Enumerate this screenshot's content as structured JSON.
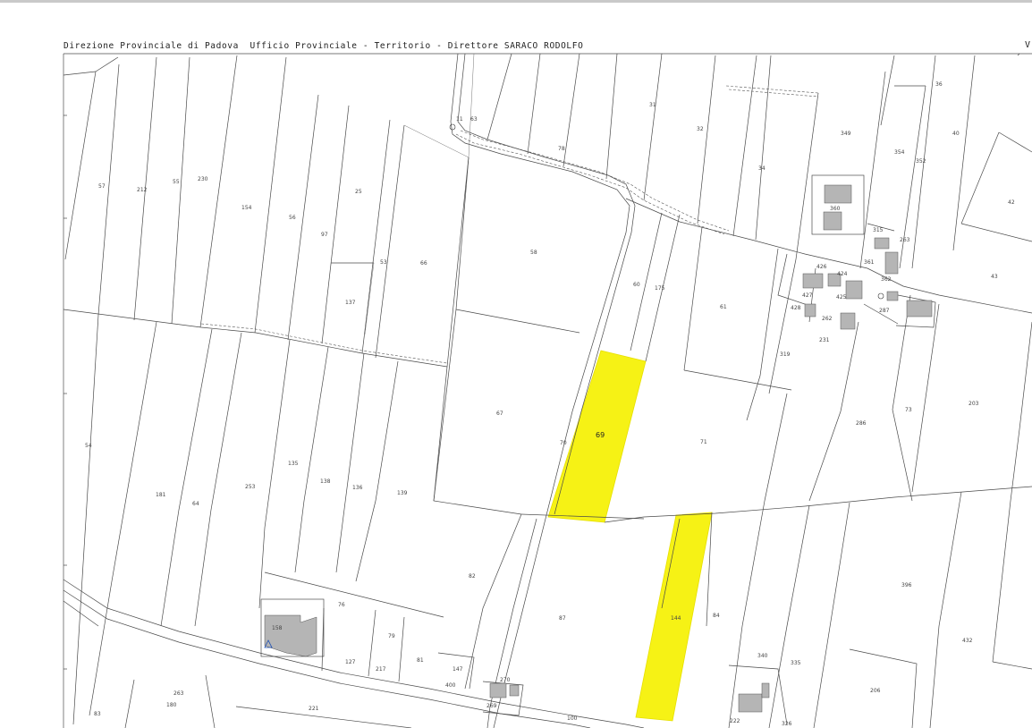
{
  "header": {
    "text": "Direzione Provinciale di Padova  Ufficio Provinciale - Territorio - Direttore SARACO RODOLFO",
    "corner": "V"
  },
  "map": {
    "highlight_color": "#f6f215",
    "highlighted_parcels": [
      "69",
      "144"
    ],
    "parcels": [
      {
        "id": "p57",
        "label": "57"
      },
      {
        "id": "p212",
        "label": "212"
      },
      {
        "id": "p55",
        "label": "55"
      },
      {
        "id": "p230",
        "label": "230"
      },
      {
        "id": "p154",
        "label": "154"
      },
      {
        "id": "p56",
        "label": "56"
      },
      {
        "id": "p25",
        "label": "25"
      },
      {
        "id": "p97",
        "label": "97"
      },
      {
        "id": "p53",
        "label": "53"
      },
      {
        "id": "p66",
        "label": "66"
      },
      {
        "id": "p137",
        "label": "137"
      },
      {
        "id": "p11",
        "label": "11"
      },
      {
        "id": "p63",
        "label": "63"
      },
      {
        "id": "p78",
        "label": "78"
      },
      {
        "id": "p31",
        "label": "31"
      },
      {
        "id": "p32",
        "label": "32"
      },
      {
        "id": "p349",
        "label": "349"
      },
      {
        "id": "p36",
        "label": "36"
      },
      {
        "id": "p40",
        "label": "40"
      },
      {
        "id": "p354",
        "label": "354"
      },
      {
        "id": "p352",
        "label": "352"
      },
      {
        "id": "p34",
        "label": "34"
      },
      {
        "id": "p360",
        "label": "360"
      },
      {
        "id": "p42",
        "label": "42"
      },
      {
        "id": "p58",
        "label": "58"
      },
      {
        "id": "p60",
        "label": "60"
      },
      {
        "id": "p175",
        "label": "175"
      },
      {
        "id": "p61",
        "label": "61"
      },
      {
        "id": "p315",
        "label": "315"
      },
      {
        "id": "p263",
        "label": "263"
      },
      {
        "id": "p361",
        "label": "361"
      },
      {
        "id": "p362",
        "label": "362"
      },
      {
        "id": "p43",
        "label": "43"
      },
      {
        "id": "p426",
        "label": "426"
      },
      {
        "id": "p424",
        "label": "424"
      },
      {
        "id": "p427",
        "label": "427"
      },
      {
        "id": "p425",
        "label": "425"
      },
      {
        "id": "p428",
        "label": "428"
      },
      {
        "id": "p262",
        "label": "262"
      },
      {
        "id": "p287",
        "label": "287"
      },
      {
        "id": "p231",
        "label": "231"
      },
      {
        "id": "p319",
        "label": "319"
      },
      {
        "id": "p54",
        "label": "54"
      },
      {
        "id": "p67",
        "label": "67"
      },
      {
        "id": "p69",
        "label": "69"
      },
      {
        "id": "p70",
        "label": "70"
      },
      {
        "id": "p71",
        "label": "71"
      },
      {
        "id": "p286",
        "label": "286"
      },
      {
        "id": "p73",
        "label": "73"
      },
      {
        "id": "p203",
        "label": "203"
      },
      {
        "id": "p181",
        "label": "181"
      },
      {
        "id": "p64",
        "label": "64"
      },
      {
        "id": "p253",
        "label": "253"
      },
      {
        "id": "p135",
        "label": "135"
      },
      {
        "id": "p138",
        "label": "138"
      },
      {
        "id": "p136",
        "label": "136"
      },
      {
        "id": "p139",
        "label": "139"
      },
      {
        "id": "p82",
        "label": "82"
      },
      {
        "id": "p396",
        "label": "396"
      },
      {
        "id": "p76",
        "label": "76"
      },
      {
        "id": "p158",
        "label": "158"
      },
      {
        "id": "p79",
        "label": "79"
      },
      {
        "id": "p81",
        "label": "81"
      },
      {
        "id": "p127",
        "label": "127"
      },
      {
        "id": "p217",
        "label": "217"
      },
      {
        "id": "p147",
        "label": "147"
      },
      {
        "id": "p400",
        "label": "400"
      },
      {
        "id": "p87",
        "label": "87"
      },
      {
        "id": "p144",
        "label": "144"
      },
      {
        "id": "p84",
        "label": "84"
      },
      {
        "id": "p340",
        "label": "340"
      },
      {
        "id": "p335",
        "label": "335"
      },
      {
        "id": "p432",
        "label": "432"
      },
      {
        "id": "p206",
        "label": "206"
      },
      {
        "id": "p270",
        "label": "270"
      },
      {
        "id": "p269",
        "label": "269"
      },
      {
        "id": "p100",
        "label": "100"
      },
      {
        "id": "p222",
        "label": "222"
      },
      {
        "id": "p326",
        "label": "326"
      },
      {
        "id": "p263b",
        "label": "263"
      },
      {
        "id": "p180",
        "label": "180"
      },
      {
        "id": "p221",
        "label": "221"
      },
      {
        "id": "p83",
        "label": "83"
      }
    ]
  }
}
